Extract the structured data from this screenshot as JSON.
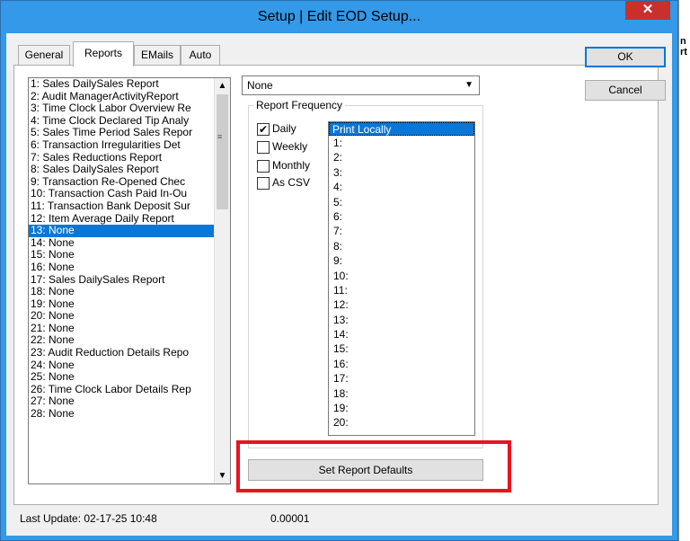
{
  "window": {
    "title": "Setup | Edit EOD Setup...",
    "close_glyph": "✕"
  },
  "background_window": {
    "lines": [
      "n",
      "rt"
    ]
  },
  "tabs": [
    {
      "label": "General",
      "active": false
    },
    {
      "label": "Reports",
      "active": true
    },
    {
      "label": "EMails",
      "active": false
    },
    {
      "label": "Auto",
      "active": false
    }
  ],
  "reports_list": {
    "selected_index": 12,
    "items": [
      "1: Sales DailySales Report",
      "2: Audit ManagerActivityReport",
      "3: Time Clock Labor Overview Re",
      "4: Time Clock Declared Tip Analy",
      "5: Sales Time Period Sales Repor",
      "6: Transaction Irregularities Det",
      "7: Sales Reductions Report",
      "8: Sales DailySales Report",
      "9: Transaction Re-Opened Chec",
      "10: Transaction Cash Paid In-Ou",
      "11: Transaction Bank Deposit Sur",
      "12: Item Average Daily Report",
      "13: None",
      "14: None",
      "15: None",
      "16: None",
      "17: Sales DailySales Report",
      "18: None",
      "19: None",
      "20: None",
      "21: None",
      "22: None",
      "23: Audit Reduction Details Repo",
      "24: None",
      "25: None",
      "26: Time Clock Labor Details Rep",
      "27: None",
      "28: None"
    ]
  },
  "report_dropdown": {
    "value": "None"
  },
  "report_frequency": {
    "label": "Report Frequency",
    "options": [
      {
        "label": "Daily",
        "checked": true
      },
      {
        "label": "Weekly",
        "checked": false
      },
      {
        "label": "Monthly",
        "checked": false
      },
      {
        "label": "As CSV",
        "checked": false
      }
    ]
  },
  "print_list": {
    "header": "Print Locally",
    "items": [
      "1:",
      "2:",
      "3:",
      "4:",
      "5:",
      "6:",
      "7:",
      "8:",
      "9:",
      "10:",
      "11:",
      "12:",
      "13:",
      "14:",
      "15:",
      "16:",
      "17:",
      "18:",
      "19:",
      "20:"
    ]
  },
  "buttons": {
    "ok": "OK",
    "cancel": "Cancel",
    "set_defaults": "Set Report Defaults"
  },
  "status": {
    "last_update": "Last Update:  02-17-25 10:48",
    "value": "0.00001"
  },
  "colors": {
    "selection": "#0a77d6",
    "highlight_box": "#e8141c",
    "titlebar": "#3399e8"
  }
}
